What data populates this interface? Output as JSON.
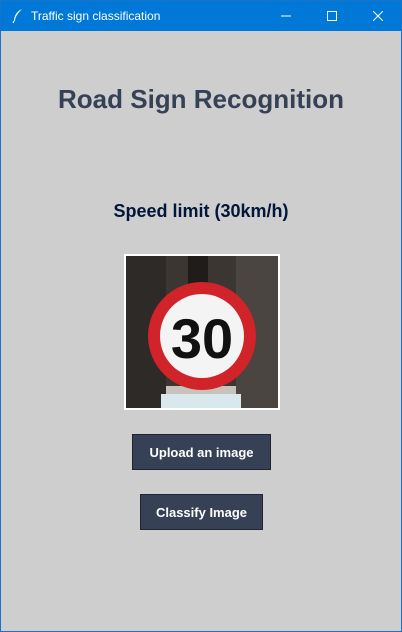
{
  "window": {
    "title": "Traffic sign classification",
    "app_icon": "feather-icon",
    "controls": {
      "minimize_icon": "minimize-icon",
      "maximize_icon": "maximize-icon",
      "close_icon": "close-icon"
    }
  },
  "main": {
    "heading": "Road Sign Recognition",
    "result_label": "Speed limit (30km/h)",
    "image": {
      "sign_text": "30"
    },
    "upload_button_label": "Upload an image",
    "classify_button_label": "Classify Image"
  },
  "colors": {
    "background": "#cecece",
    "titlebar": "#0078d7",
    "button_bg": "#364156",
    "button_text": "#ffffff",
    "heading": "#364156",
    "result": "#011638"
  }
}
